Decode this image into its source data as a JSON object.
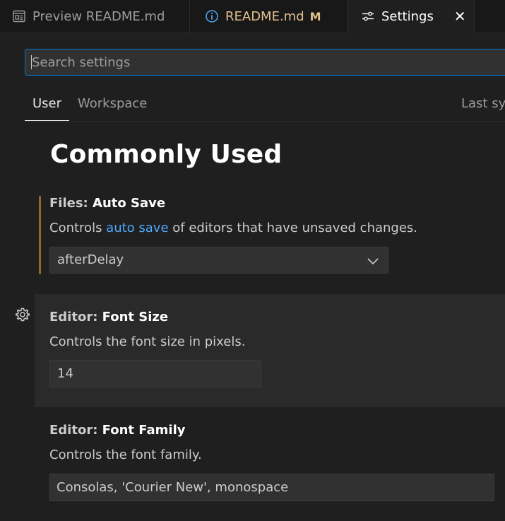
{
  "tabs": [
    {
      "label": "Preview README.md",
      "icon": "preview-icon"
    },
    {
      "label": "README.md",
      "icon": "info-icon",
      "badge": "M"
    },
    {
      "label": "Settings",
      "icon": "settings-sliders-icon",
      "close": "✕"
    }
  ],
  "search": {
    "placeholder": "Search settings"
  },
  "scopes": {
    "user": "User",
    "workspace": "Workspace",
    "sync": "Last synced"
  },
  "section": {
    "title": "Commonly Used"
  },
  "settings": {
    "auto_save": {
      "category": "Files: ",
      "name": "Auto Save",
      "desc_before": "Controls ",
      "desc_link": "auto save",
      "desc_after": " of editors that have unsaved changes.",
      "value": "afterDelay"
    },
    "font_size": {
      "category": "Editor: ",
      "name": "Font Size",
      "desc": "Controls the font size in pixels.",
      "value": "14"
    },
    "font_family": {
      "category": "Editor: ",
      "name": "Font Family",
      "desc": "Controls the font family.",
      "value": "Consolas, 'Courier New', monospace"
    }
  },
  "colors": {
    "accent": "#0078d4",
    "modified": "#e2c08d",
    "link": "#4daafc",
    "background": "#1f1f1f"
  }
}
